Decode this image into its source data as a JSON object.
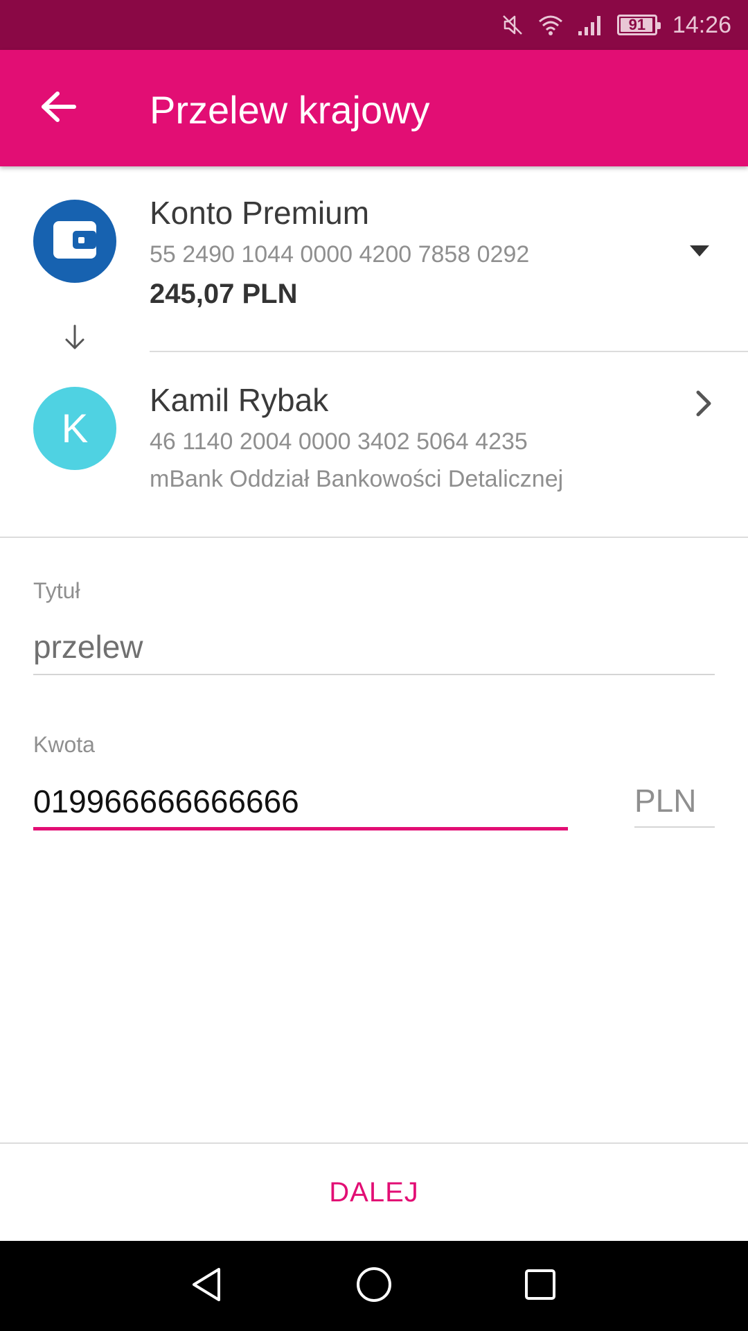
{
  "status_bar": {
    "time": "14:26",
    "battery_level": "91",
    "icons": [
      "muted-icon",
      "wifi-icon",
      "signal-icon",
      "battery-icon"
    ]
  },
  "app_bar": {
    "title": "Przelew krajowy",
    "back_icon": "arrow-back-icon"
  },
  "from_account": {
    "name": "Konto Premium",
    "number": "55 2490 1044 0000 4200 7858 0292",
    "balance": "245,07 PLN",
    "icon": "wallet-icon",
    "icon_bg": "#1762b0"
  },
  "recipient": {
    "initial": "K",
    "name": "Kamil Rybak",
    "number": "46 1140 2004 0000 3402 5064 4235",
    "bank": "mBank Oddział Bankowości Detalicznej",
    "avatar_bg": "#4fd2e2"
  },
  "form": {
    "title_label": "Tytuł",
    "title_value": "przelew",
    "amount_label": "Kwota",
    "amount_value": "019966666666666",
    "currency": "PLN"
  },
  "actions": {
    "next_label": "DALEJ"
  },
  "colors": {
    "accent": "#e20e74",
    "status_bar": "#8a0845"
  }
}
